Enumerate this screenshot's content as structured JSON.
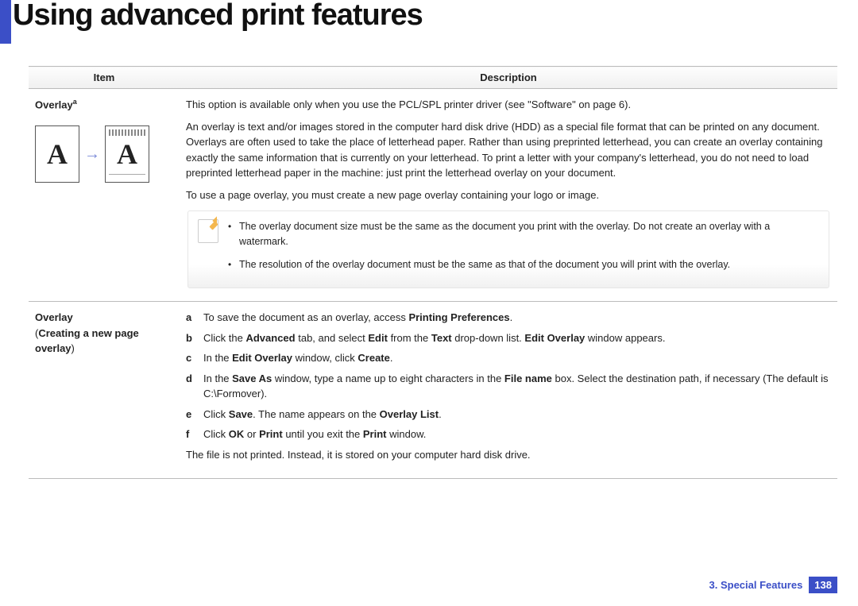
{
  "page_title": "Using advanced print features",
  "table": {
    "headers": {
      "item": "Item",
      "description": "Description"
    },
    "rows": [
      {
        "item_label": "Overlay",
        "item_sup": "a",
        "desc": {
          "p1": "This option is available only when you use the PCL/SPL printer driver (see \"Software\" on page 6).",
          "p2": "An overlay is text and/or images stored in the computer hard disk drive (HDD) as a special file format that can be printed on any document. Overlays are often used to take the place of letterhead paper. Rather than using preprinted letterhead, you can create an overlay containing exactly the same information that is currently on your letterhead. To print a letter with your company's letterhead, you do not need to load preprinted letterhead paper in the machine: just print the letterhead overlay on your document.",
          "p3": "To use a page overlay, you must create a new page overlay containing your logo or image.",
          "note_items": [
            "The overlay document size must be the same as the document you print with the overlay. Do not create an overlay with a watermark.",
            "The resolution of the overlay document must be the same as that of the document you will print with the overlay."
          ]
        }
      },
      {
        "item_label": "Overlay",
        "item_sub_open": "(",
        "item_sub_text": "Creating a new page overlay",
        "item_sub_close": ")",
        "steps": {
          "a": {
            "pre": "To save the document as an overlay, access ",
            "b1": "Printing Preferences",
            "post": "."
          },
          "b": {
            "pre": "Click the ",
            "b1": "Advanced",
            "mid1": " tab, and select ",
            "b2": "Edit",
            "mid2": " from the ",
            "b3": "Text",
            "mid3": " drop-down list. ",
            "b4": "Edit Overlay",
            "post": " window appears."
          },
          "c": {
            "pre": "In the ",
            "b1": "Edit Overlay",
            "mid1": " window, click ",
            "b2": "Create",
            "post": "."
          },
          "d": {
            "pre": "In the ",
            "b1": "Save As",
            "mid1": " window, type a name up to eight characters in the ",
            "b2": "File name",
            "post": " box. Select the destination path, if necessary (The default is C:\\Formover)."
          },
          "e": {
            "pre": "Click ",
            "b1": "Save",
            "mid1": ". The name appears on the ",
            "b2": "Overlay List",
            "post": "."
          },
          "f": {
            "pre": "Click ",
            "b1": "OK",
            "mid1": " or ",
            "b2": "Print",
            "mid2": " until you exit the ",
            "b3": "Print",
            "post": " window."
          }
        },
        "trailing": "The file is not printed. Instead, it is stored on your computer hard disk drive."
      }
    ]
  },
  "figure": {
    "glyph": "A"
  },
  "footer": {
    "chapter": "3.  Special Features",
    "page_number": "138"
  }
}
